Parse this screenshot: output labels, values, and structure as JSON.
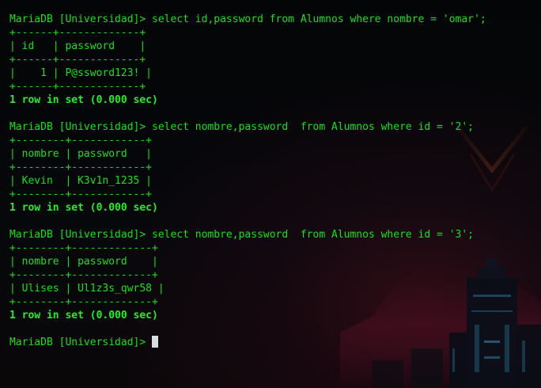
{
  "terminal": {
    "lines": [
      "MariaDB [Universidad]> select id,password from Alumnos where nombre = 'omar';",
      "+------+-------------+",
      "| id   | password    |",
      "+------+-------------+",
      "|    1 | P@ssword123! |",
      "+------+-------------+",
      "1 row in set (0.000 sec)",
      "",
      "MariaDB [Universidad]> select nombre,password  from Alumnos where id = '2';",
      "+--------+------------+",
      "| nombre | password   |",
      "+--------+------------+",
      "| Kevin  | K3v1n_1235 |",
      "+--------+------------+",
      "1 row in set (0.000 sec)",
      "",
      "MariaDB [Universidad]> select nombre,password  from Alumnos where id = '3';",
      "+--------+-------------+",
      "| nombre | password    |",
      "+--------+-------------+",
      "| Ulises | Ul1z3s_qwr58 |",
      "+--------+-------------+",
      "1 row in set (0.000 sec)",
      "",
      "MariaDB [Universidad]> "
    ]
  },
  "colors": {
    "text": "#19e01a",
    "cursor": "#d8dde0",
    "background": "#05070a",
    "wallpaper_accent": "#8a1a2e"
  }
}
